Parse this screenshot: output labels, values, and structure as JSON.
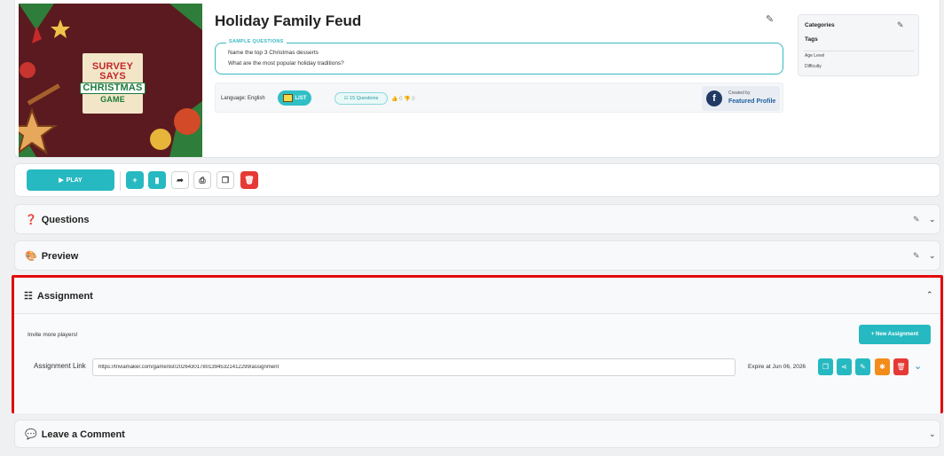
{
  "game": {
    "title": "Holiday Family Feud",
    "thumbnail_lines": [
      "SURVEY",
      "SAYS",
      "CHRISTMAS",
      "GAME"
    ],
    "samples_label": "SAMPLE QUESTIONS",
    "sample_questions": [
      "Name the top 3 Christmas desserts",
      "What are the most popular holiday traditions?"
    ],
    "language_label": "Language:  English",
    "list_label": "LIST",
    "questions_count_label": "☷ 15  Questions",
    "likes_label": "👍 0  👎 0",
    "created_by_label": "Created by",
    "creator_name": "Featured Profile"
  },
  "categories_panel": {
    "categories_label": "Categories",
    "tags_label": "Tags",
    "age_level_label": "Age Level",
    "difficulty_label": "Difficulty"
  },
  "toolbar": {
    "play_label": "PLAY",
    "play_icon": "▶",
    "add_icon": "+",
    "bookmark_icon": "▮",
    "share_icon": "➦",
    "print_icon": "⎙",
    "copy_icon": "❐",
    "delete_icon": "🗑"
  },
  "sections": {
    "questions": {
      "title": "Questions",
      "icon": "❓"
    },
    "preview": {
      "title": "Preview",
      "icon": "🎨"
    },
    "assignment": {
      "title": "Assignment",
      "icon": "☷"
    },
    "comment": {
      "title": "Leave a Comment",
      "icon": "💬"
    }
  },
  "assignment": {
    "invite_text": "Invite more players!",
    "new_assignment_label": "+ New Assignment",
    "link_label": "Assignment Link",
    "link_value": "https://triviamaker.com/game/list/20264301780139453214122​99/assignment",
    "expire_text": "Expire at Jun 06, 2026"
  },
  "colors": {
    "accent_teal": "#27b9c1",
    "danger_red": "#e53935",
    "warning_orange": "#f28c1b",
    "highlight_border": "#e10b0b"
  }
}
